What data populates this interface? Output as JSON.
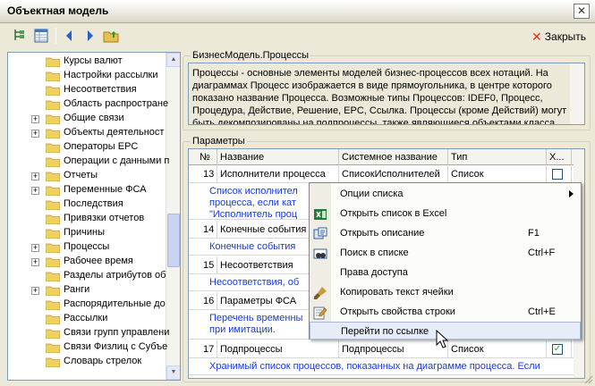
{
  "window": {
    "title": "Объектная модель"
  },
  "toolbar": {
    "close_label": "Закрыть"
  },
  "tree": {
    "items": [
      {
        "label": "Курсы валют",
        "expander": ""
      },
      {
        "label": "Настройки рассылки",
        "expander": ""
      },
      {
        "label": "Несоответствия",
        "expander": ""
      },
      {
        "label": "Область распростране",
        "expander": ""
      },
      {
        "label": "Общие связи",
        "expander": "+"
      },
      {
        "label": "Объекты деятельност",
        "expander": "+"
      },
      {
        "label": "Операторы EPC",
        "expander": ""
      },
      {
        "label": "Операции с данными п",
        "expander": ""
      },
      {
        "label": "Отчеты",
        "expander": "+"
      },
      {
        "label": "Переменные ФСА",
        "expander": "+"
      },
      {
        "label": "Последствия",
        "expander": ""
      },
      {
        "label": "Привязки отчетов",
        "expander": ""
      },
      {
        "label": "Причины",
        "expander": ""
      },
      {
        "label": "Процессы",
        "expander": "+"
      },
      {
        "label": "Рабочее время",
        "expander": "+"
      },
      {
        "label": "Разделы атрибутов об",
        "expander": ""
      },
      {
        "label": "Ранги",
        "expander": "+"
      },
      {
        "label": "Распорядительные до",
        "expander": ""
      },
      {
        "label": "Рассылки",
        "expander": ""
      },
      {
        "label": "Связи групп управлени",
        "expander": ""
      },
      {
        "label": "Связи Физлиц с Субъе",
        "expander": ""
      },
      {
        "label": "Словарь стрелок",
        "expander": ""
      }
    ]
  },
  "description": {
    "group_title": "БизнесМодель.Процессы",
    "text": "Процессы - основные элементы моделей бизнес-процессов всех нотаций. На диаграммах Процесс изображается в виде прямоугольника, в центре которого показано название Процесса. Возможные типы Процессов: IDEF0, Процесс, Процедура, Действие, Решение, EPC, Ссылка.  Процессы (кроме Действий) могут быть декомпозированы на подпроцессы, также являющиеся объектами класса"
  },
  "params": {
    "group_title": "Параметры",
    "headers": {
      "num": "№",
      "name": "Название",
      "sys": "Системное название",
      "type": "Тип",
      "x": "Х..."
    },
    "rows": [
      {
        "num": "13",
        "name": "Исполнители процесса",
        "sys": "СписокИсполнителей",
        "type": "Список",
        "checked": "",
        "desc_l1": "Список исполнител",
        "desc_l2": "процесса, если кат",
        "desc_l3": "\"Исполнитель проц"
      },
      {
        "num": "14",
        "name": "Конечные события",
        "sys": "",
        "type": "",
        "checked": "",
        "desc_l1": "Конечные события",
        "desc_l2": "",
        "desc_l3": ""
      },
      {
        "num": "15",
        "name": "Несоответствия",
        "sys": "",
        "type": "",
        "checked": "",
        "desc_l1": "Несоответствия, об",
        "desc_l2": "",
        "desc_l3": ""
      },
      {
        "num": "16",
        "name": "Параметры ФСА",
        "sys": "",
        "type": "",
        "checked": "",
        "desc_l1": "Перечень временны",
        "desc_l2": "при имитации.",
        "desc_l3": ""
      },
      {
        "num": "17",
        "name": "Подпроцессы",
        "sys": "Подпроцессы",
        "type": "Список",
        "checked": "✓",
        "desc_l1": "Хранимый список процессов, показанных на диаграмме процесса. Если",
        "desc_l2": "",
        "desc_l3": ""
      }
    ]
  },
  "context_menu": {
    "items": [
      {
        "label": "Опции списка",
        "shortcut": "",
        "icon": "none",
        "submenu": true
      },
      {
        "label": "Открыть список в Excel",
        "shortcut": "",
        "icon": "excel-icon"
      },
      {
        "label": "Открыть описание",
        "shortcut": "F1",
        "icon": "description-icon"
      },
      {
        "label": "Поиск в списке",
        "shortcut": "Ctrl+F",
        "icon": "binoculars-icon"
      },
      {
        "label": "Права доступа",
        "shortcut": "",
        "icon": "none"
      },
      {
        "label": "Копировать текст ячейки",
        "shortcut": "",
        "icon": "brush-icon"
      },
      {
        "label": "Открыть свойства строки",
        "shortcut": "Ctrl+E",
        "icon": "edit-icon"
      },
      {
        "label": "Перейти по ссылке",
        "shortcut": "",
        "icon": "none"
      }
    ]
  }
}
